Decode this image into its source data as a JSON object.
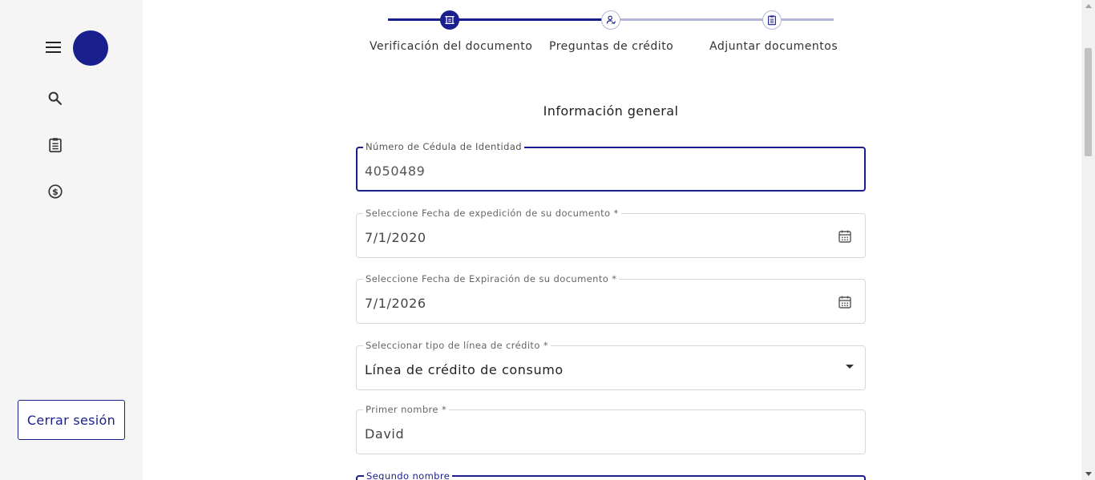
{
  "sidebar": {
    "menu_icon": "hamburger-menu-icon",
    "avatar_color": "#1a1f8e",
    "icons": [
      "search-icon",
      "clipboard-icon",
      "dollar-icon"
    ],
    "logout_label": "Cerrar sesión"
  },
  "stepper": {
    "steps": [
      {
        "label": "Verificación del documento",
        "icon": "document-scan-icon",
        "state": "active"
      },
      {
        "label": "Preguntas de crédito",
        "icon": "person-sign-icon",
        "state": "pending"
      },
      {
        "label": "Adjuntar documentos",
        "icon": "clipboard-list-icon",
        "state": "pending"
      }
    ],
    "progress_color": "#1a1f8e",
    "pending_color": "#b3b6d9"
  },
  "form": {
    "title": "Información general",
    "fields": [
      {
        "label": "Número de Cédula de Identidad",
        "value": "4050489",
        "state": "focused"
      },
      {
        "label": "Seleccione Fecha de expedición de su documento *",
        "value": "7/1/2020",
        "icon": "calendar-icon"
      },
      {
        "label": "Seleccione Fecha de Expiración de su documento *",
        "value": "7/1/2026",
        "icon": "calendar-icon"
      },
      {
        "label": "Seleccionar tipo de línea de crédito *",
        "value": "Línea de crédito de consumo",
        "icon": "dropdown-caret-icon"
      },
      {
        "label": "Primer nombre *",
        "value": "David"
      },
      {
        "label": "Segundo nombre",
        "value": "",
        "state": "focused"
      }
    ]
  },
  "colors": {
    "accent": "#1a1f8e",
    "sidebar_bg": "#f5f5f5",
    "border": "#d7d7d7"
  }
}
